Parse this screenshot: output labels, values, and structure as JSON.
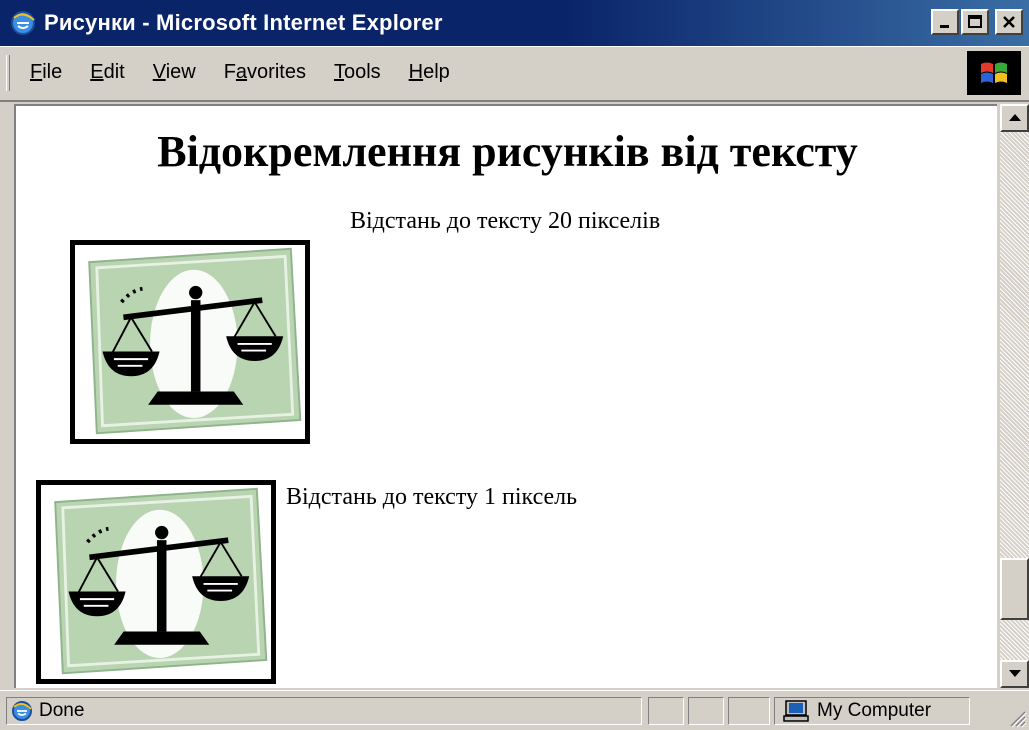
{
  "window": {
    "title": "Рисунки - Microsoft Internet Explorer",
    "controls": [
      "minimize",
      "maximize",
      "close"
    ]
  },
  "menu": {
    "items": [
      {
        "label": "File",
        "accel": "F",
        "rest": "ile"
      },
      {
        "label": "Edit",
        "accel": "E",
        "rest": "dit"
      },
      {
        "label": "View",
        "accel": "V",
        "rest": "iew"
      },
      {
        "label": "Favorites",
        "pre": "F",
        "accel": "a",
        "rest": "vorites"
      },
      {
        "label": "Tools",
        "accel": "T",
        "rest": "ools"
      },
      {
        "label": "Help",
        "accel": "H",
        "rest": "elp"
      }
    ]
  },
  "page": {
    "heading": "Відокремлення рисунків від тексту",
    "caption_20": "Відстань до тексту 20 пікселів",
    "caption_1": "Відстань до тексту 1 піксель",
    "image_subject": "scales-of-justice"
  },
  "status": {
    "text": "Done",
    "zone": "My Computer"
  },
  "icons": {
    "app": "ie-icon",
    "logo": "windows-logo-icon",
    "zone": "computer-icon"
  },
  "colors": {
    "titlebar": "#0a246a",
    "chrome": "#d4d0c8",
    "picture_bg": "#b8d4b0"
  }
}
